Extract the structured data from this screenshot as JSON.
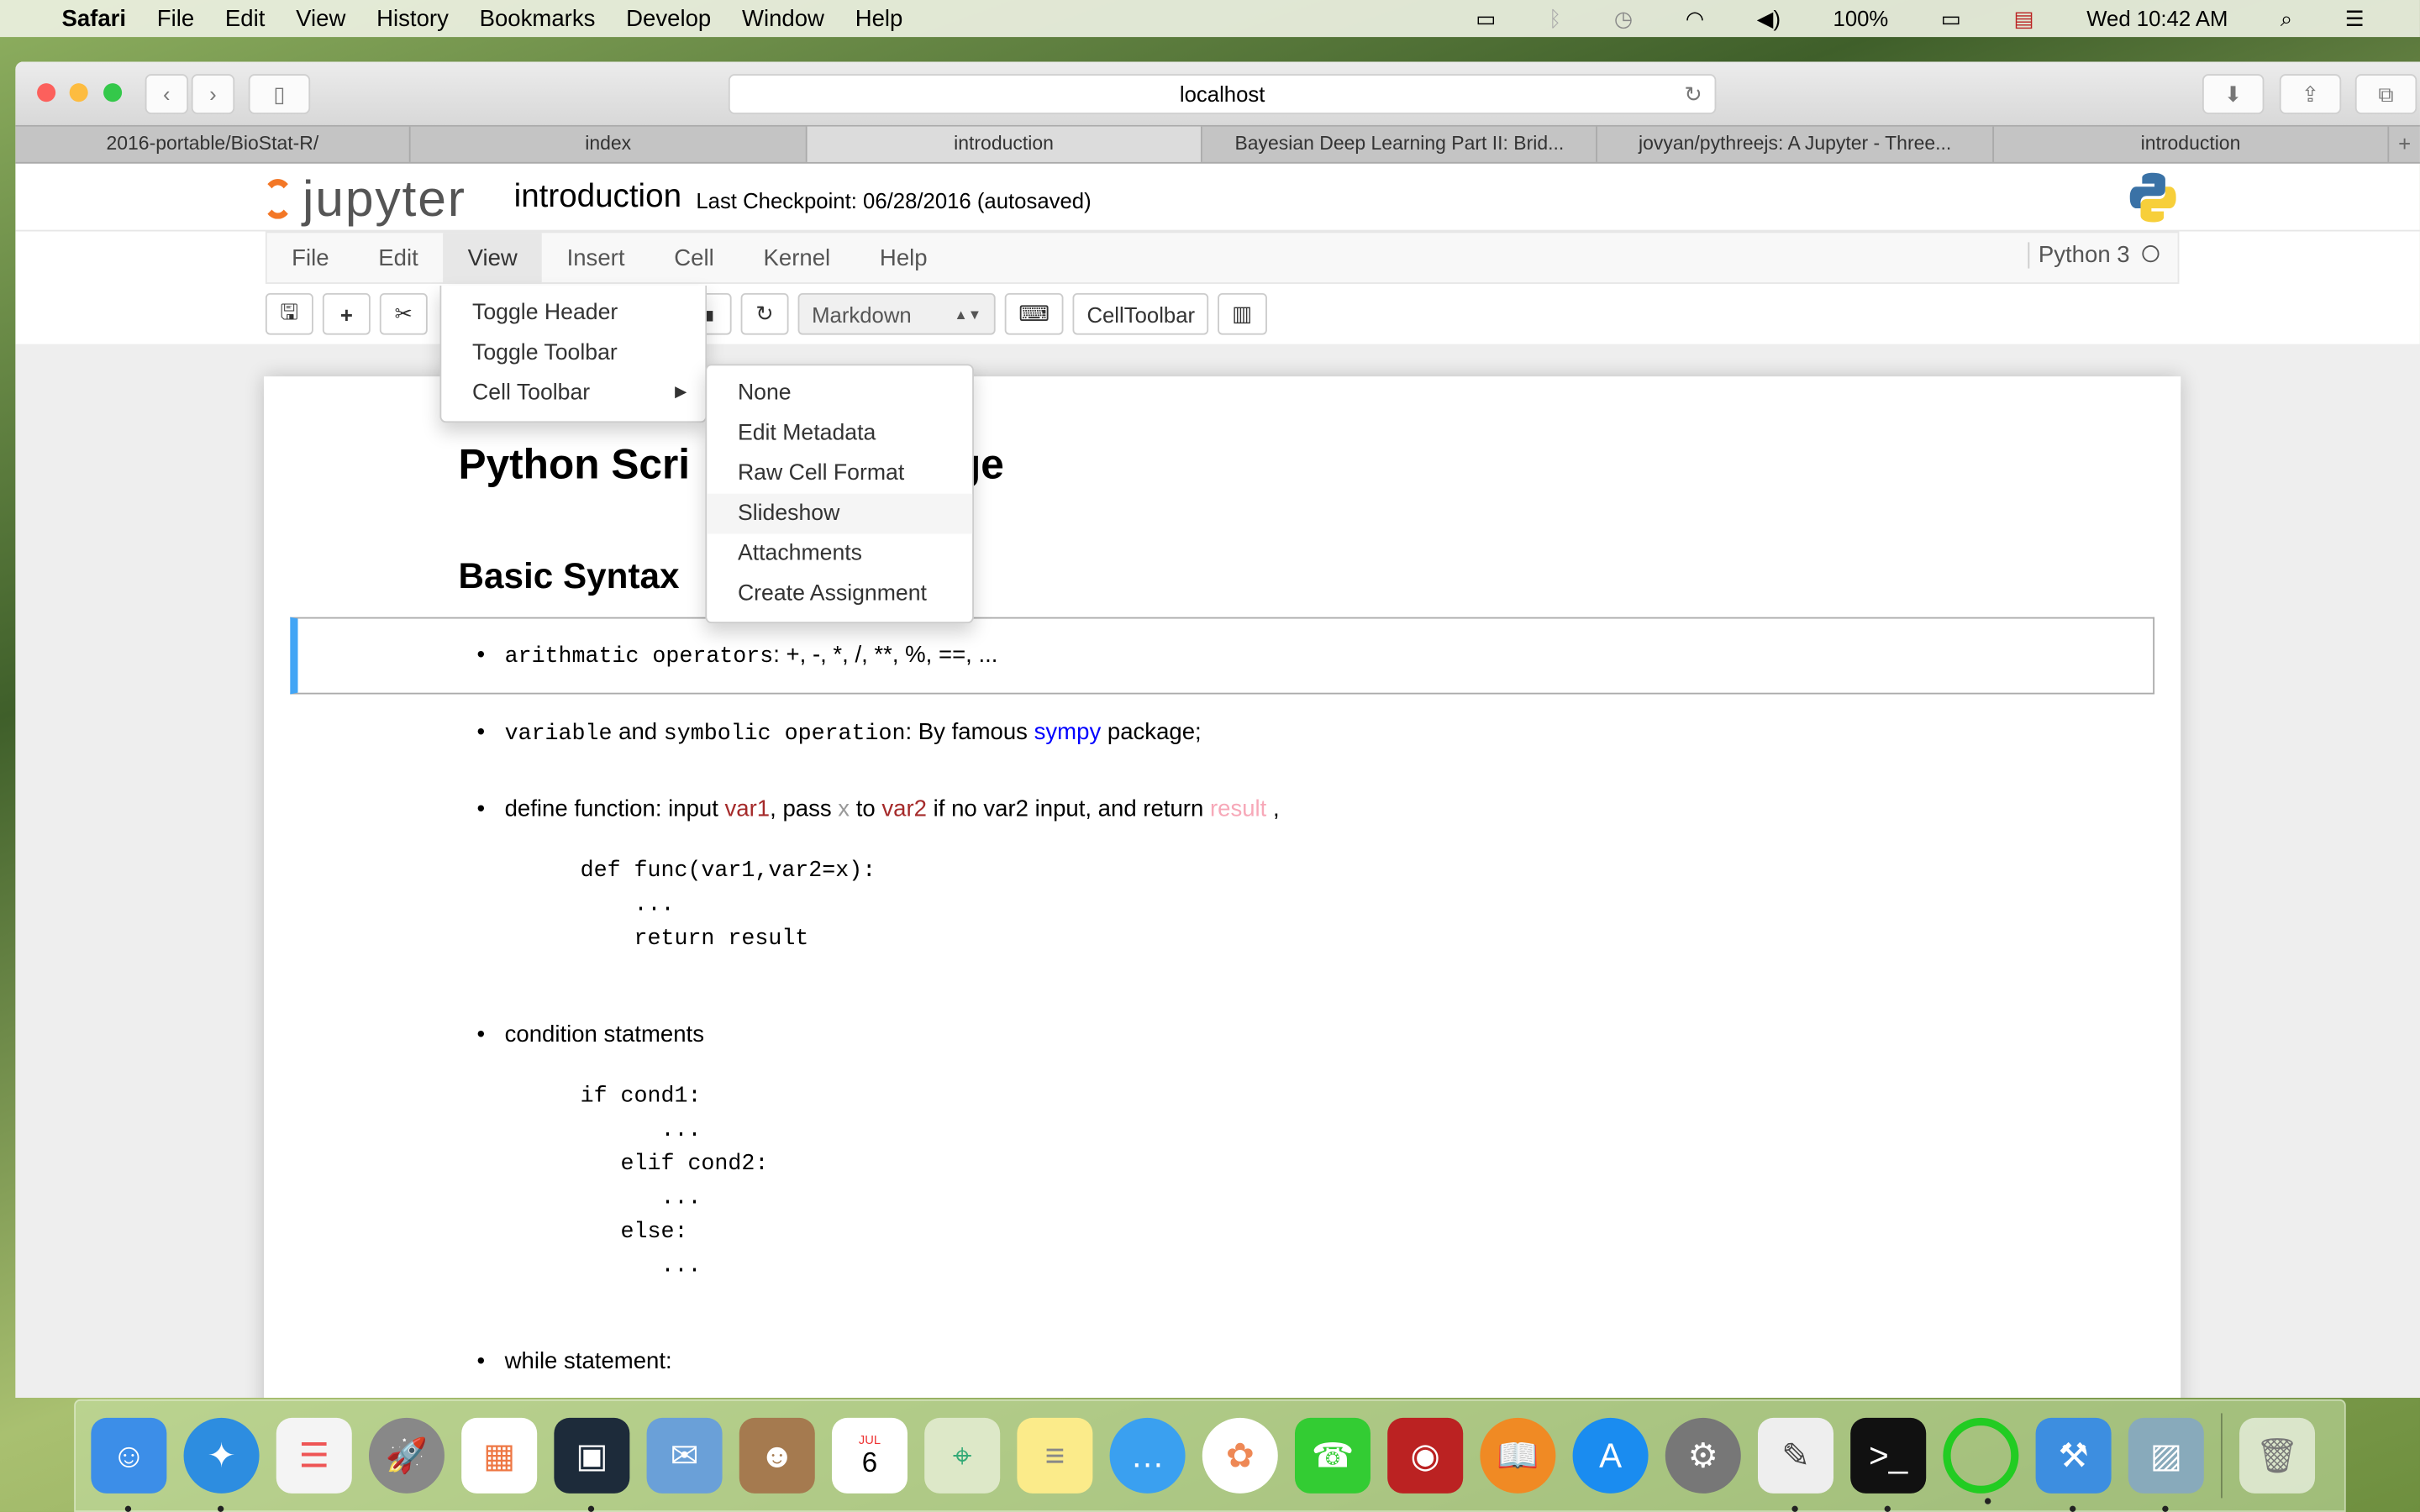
{
  "menubar": {
    "app": "Safari",
    "items": [
      "File",
      "Edit",
      "View",
      "History",
      "Bookmarks",
      "Develop",
      "Window",
      "Help"
    ],
    "battery": "100%",
    "clock": "Wed 10:42 AM"
  },
  "browser": {
    "url": "localhost",
    "tabs": [
      "2016-portable/BioStat-R/",
      "index",
      "introduction",
      "Bayesian Deep Learning Part II: Brid...",
      "jovyan/pythreejs: A Jupyter - Three...",
      "introduction"
    ],
    "active_tab": 2
  },
  "jupyter": {
    "logo_text": "jupyter",
    "notebook_name": "introduction",
    "checkpoint": "Last Checkpoint: 06/28/2016 (autosaved)",
    "menu": [
      "File",
      "Edit",
      "View",
      "Insert",
      "Cell",
      "Kernel",
      "Help"
    ],
    "kernel": "Python 3",
    "toolbar": {
      "cell_type": "Markdown",
      "celltoolbar": "CellToolbar"
    }
  },
  "view_menu": {
    "items": [
      "Toggle Header",
      "Toggle Toolbar",
      "Cell Toolbar"
    ]
  },
  "celltoolbar_submenu": {
    "items": [
      "None",
      "Edit Metadata",
      "Raw Cell Format",
      "Slideshow",
      "Attachments",
      "Create Assignment"
    ],
    "highlighted": "Slideshow"
  },
  "content": {
    "title": "Python Scripting Language",
    "title_visible_left": "Python Scri",
    "title_visible_right": "ge",
    "h2": "Basic Syntax",
    "b1_code": "arithmatic operators",
    "b1_rest": ": +, -, *, /, **, %, ==, ...",
    "b2_code1": "variable",
    "b2_and": " and ",
    "b2_code2": "symbolic operation",
    "b2_rest": ": By famous ",
    "b2_link": "sympy",
    "b2_end": " package;",
    "b3": [
      "define function: input ",
      "var1",
      ", pass ",
      "x",
      " to ",
      "var2",
      " if no var2 input, and return ",
      "result",
      " ,"
    ],
    "code1": "def func(var1,var2=x):\n    ...\n    return result",
    "b4": "condition statments",
    "code2": "if cond1:\n      ...\n   elif cond2:\n      ...\n   else:\n      ...",
    "b5": "while statement:"
  },
  "dock": [
    "finder",
    "safari",
    "reminders",
    "launchpad",
    "app-grid",
    "screen-sharing",
    "preview-mail",
    "contacts",
    "calendar",
    "maps",
    "notes",
    "messages",
    "photos",
    "facetime",
    "photo-booth",
    "ibooks",
    "app-store",
    "system-preferences",
    "textedit",
    "terminal",
    "circle-app",
    "xcode",
    "image-capture",
    "trash"
  ],
  "calendar": {
    "month": "JUL",
    "day": "6"
  }
}
